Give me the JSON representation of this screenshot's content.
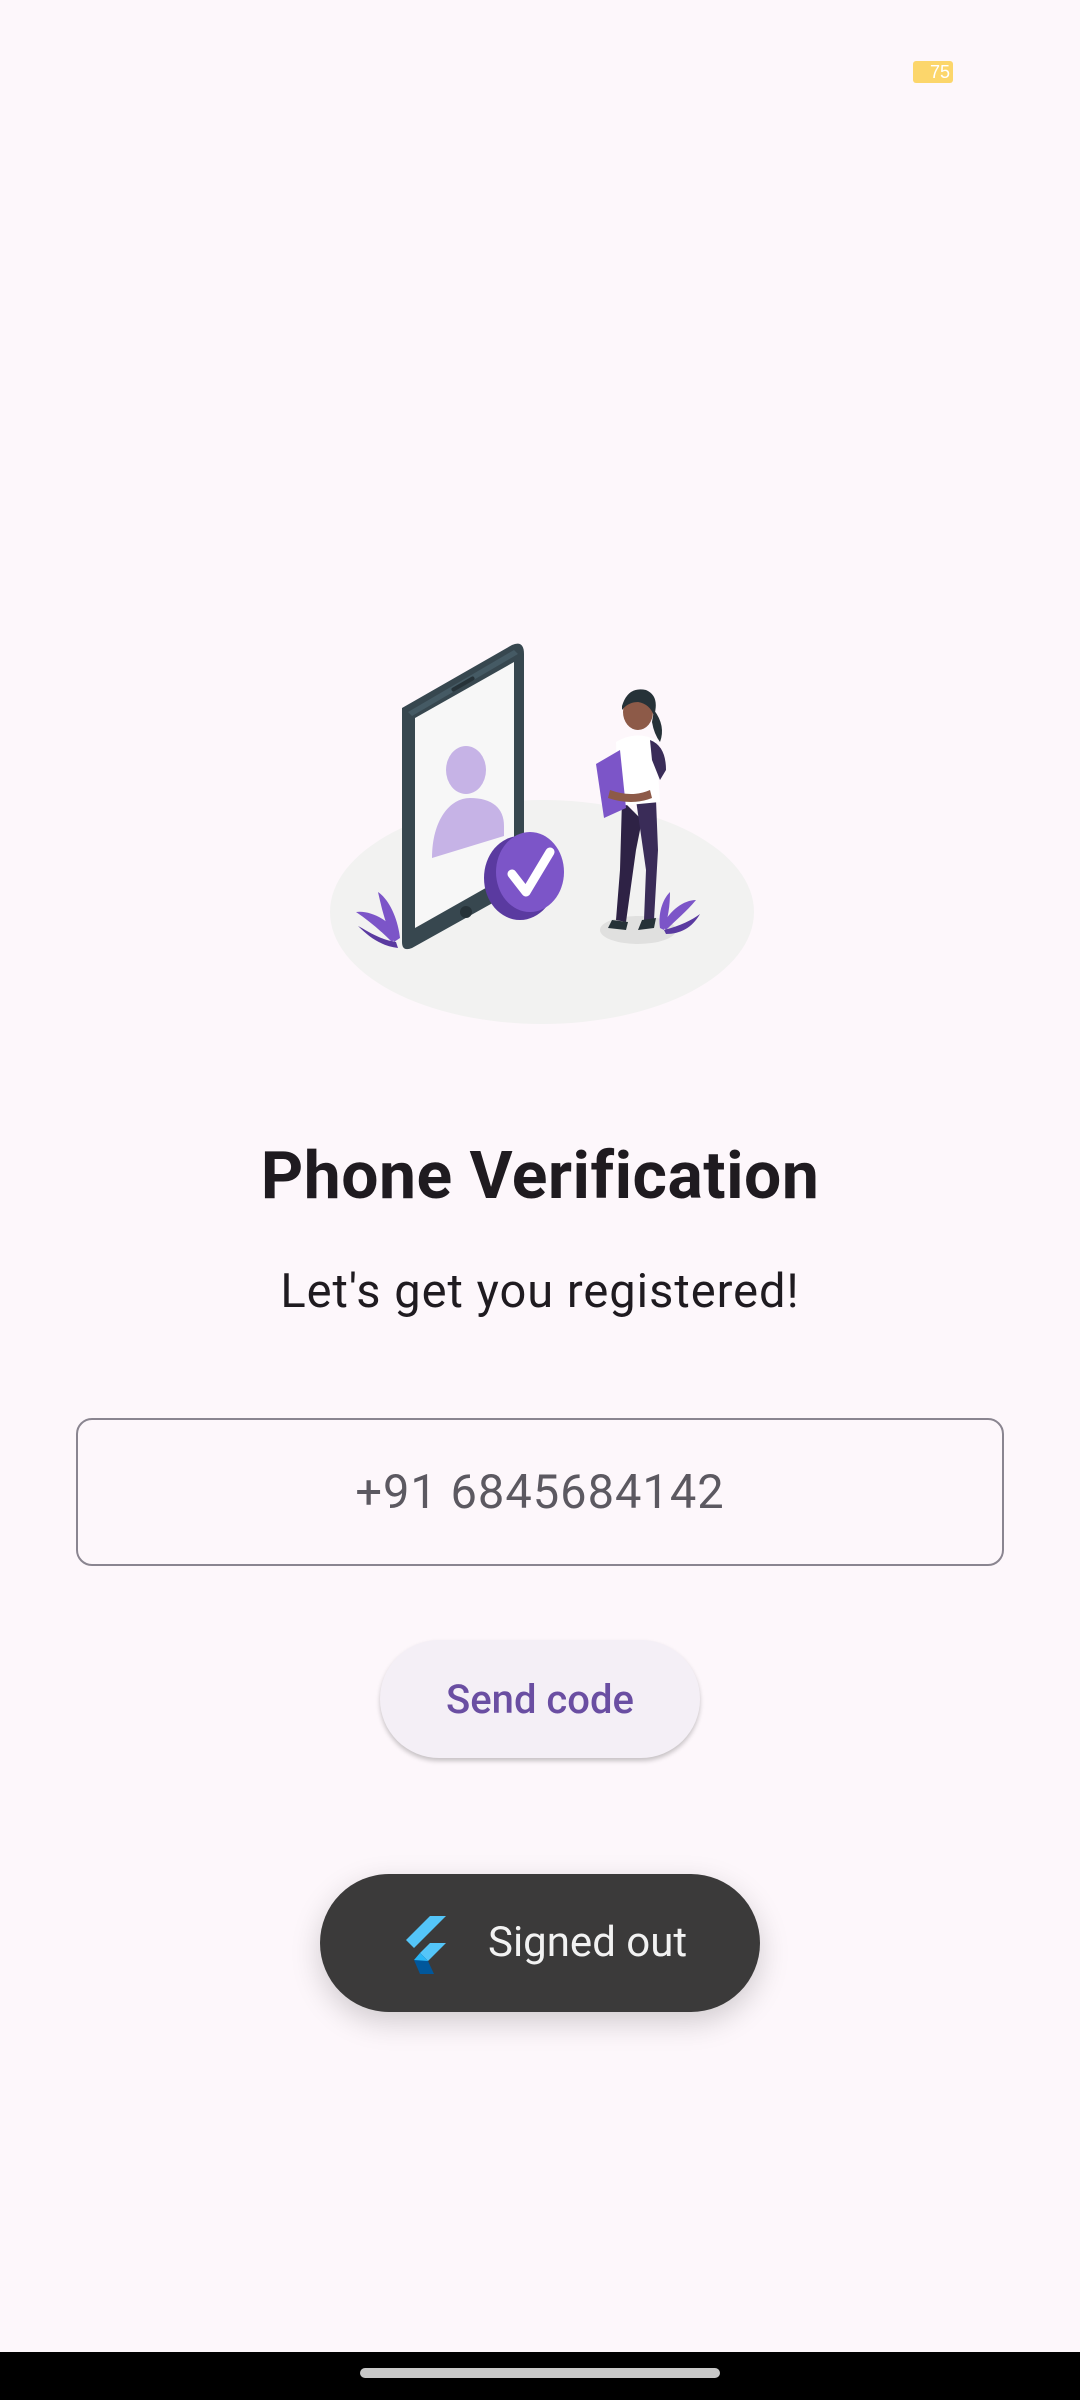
{
  "status_bar": {
    "battery_level": "75",
    "battery_color": "#fcd66b"
  },
  "illustration": {
    "icon": "phone-verification-illustration",
    "accent_color": "#7c55c8"
  },
  "page": {
    "title": "Phone Verification",
    "subtitle": "Let's get you registered!"
  },
  "phone_input": {
    "value": "+91 6845684142",
    "placeholder": ""
  },
  "send_button": {
    "label": "Send code"
  },
  "toast": {
    "icon": "flutter-icon",
    "message": "Signed out"
  },
  "colors": {
    "background": "#fdf7fb",
    "primary": "#6a4ea2",
    "toast_background": "#3b3a3a"
  }
}
